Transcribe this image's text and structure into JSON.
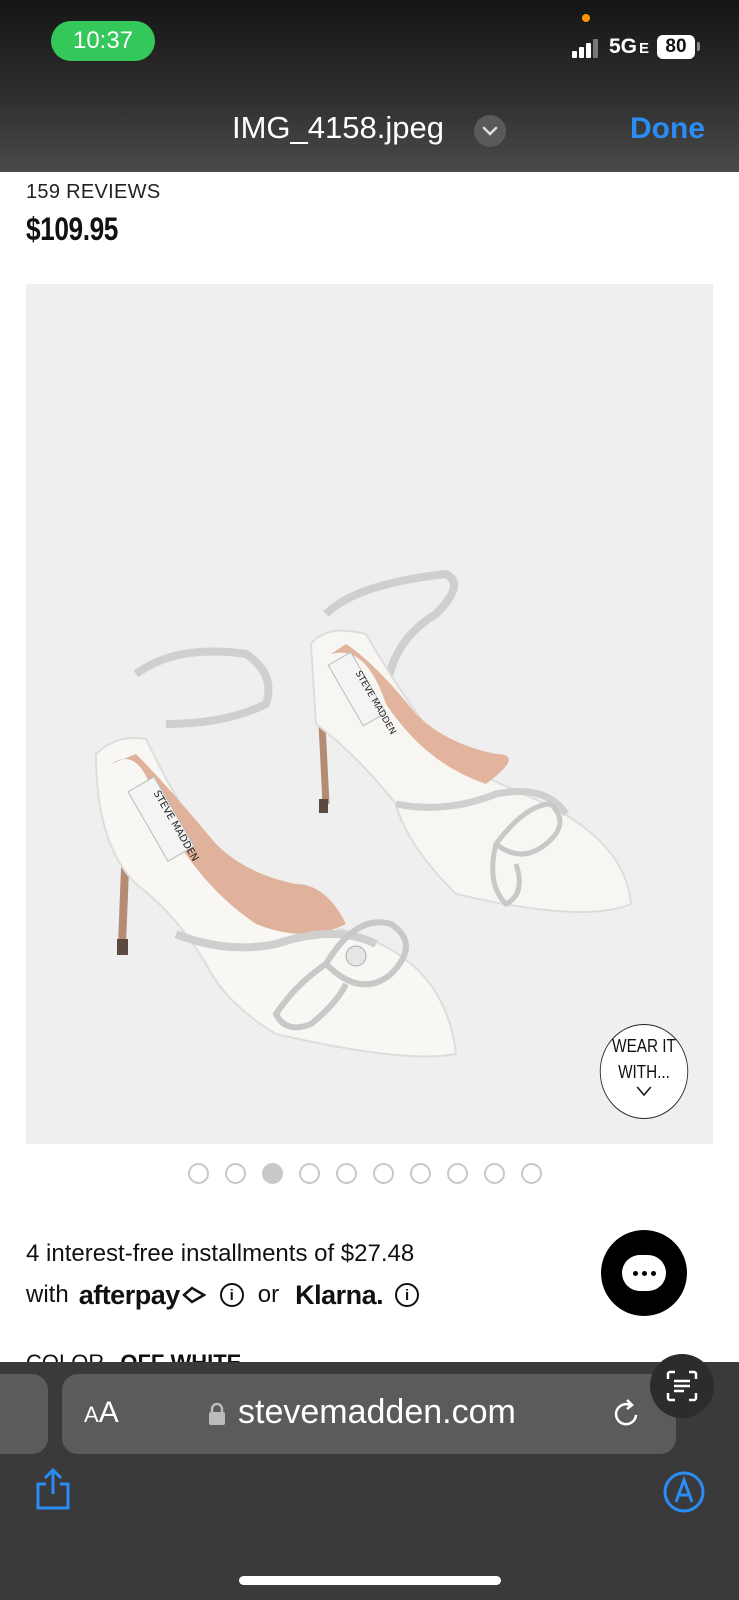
{
  "status_bar": {
    "time": "10:37",
    "network": "5G",
    "network_suffix": "E",
    "battery": "80"
  },
  "viewer": {
    "file_name": "IMG_4158.jpeg",
    "done_label": "Done"
  },
  "product": {
    "reviews": "159 REVIEWS",
    "price": "$109.95",
    "image_alt": "STEVE MADDEN",
    "wear_badge_line1": "WEAR IT",
    "wear_badge_line2": "WITH...",
    "carousel_count": 10,
    "carousel_active_index": 2
  },
  "payment": {
    "line1": "4 interest-free installments of $27.48",
    "with": "with",
    "afterpay": "afterpay",
    "or": "or",
    "klarna": "Klarna."
  },
  "color": {
    "label": "COLOR",
    "value": "OFF WHITE"
  },
  "safari": {
    "aa_label": "AA",
    "url": "stevemadden.com"
  },
  "colors": {
    "time_pill": "#34c759",
    "done": "#2b8cf4",
    "toolbar_bg": "#3a3a3c"
  }
}
